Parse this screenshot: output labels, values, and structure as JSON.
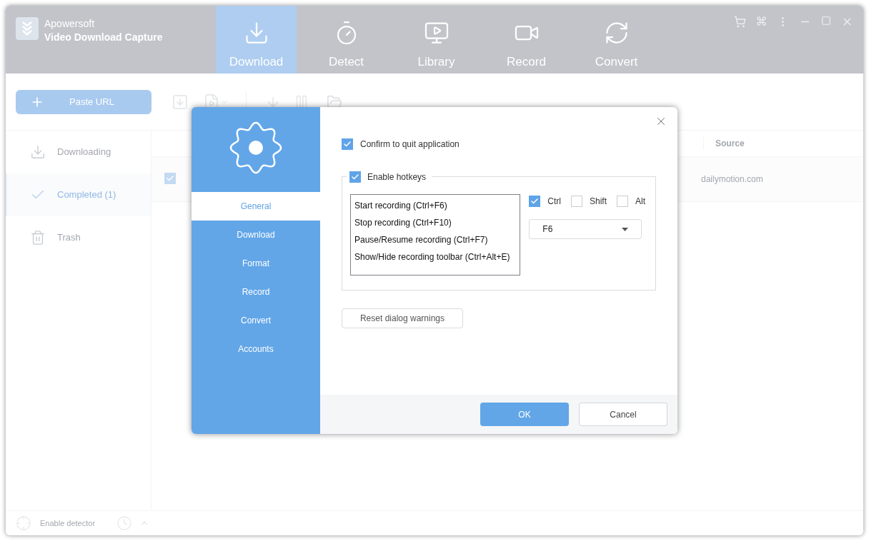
{
  "app": {
    "brand": "Apowersoft",
    "product": "Video Download Capture"
  },
  "nav_tabs": [
    {
      "label": "Download",
      "selected": true
    },
    {
      "label": "Detect",
      "selected": false
    },
    {
      "label": "Library",
      "selected": false
    },
    {
      "label": "Record",
      "selected": false
    },
    {
      "label": "Convert",
      "selected": false
    }
  ],
  "toolbar": {
    "paste_url": "Paste URL"
  },
  "sidebar": {
    "items": [
      {
        "label": "Downloading",
        "selected": false
      },
      {
        "label": "Completed (1)",
        "selected": true
      },
      {
        "label": "Trash",
        "selected": false
      }
    ]
  },
  "table": {
    "columns": [
      {
        "label": "Source"
      }
    ],
    "rows": [
      {
        "checked": true,
        "source": "dailymotion.com"
      }
    ]
  },
  "status_bar": {
    "detector": "Enable detector"
  },
  "dialog": {
    "nav": [
      {
        "label": "General",
        "selected": true
      },
      {
        "label": "Download",
        "selected": false
      },
      {
        "label": "Format",
        "selected": false
      },
      {
        "label": "Record",
        "selected": false
      },
      {
        "label": "Convert",
        "selected": false
      },
      {
        "label": "Accounts",
        "selected": false
      }
    ],
    "confirm_quit": {
      "label": "Confirm to quit application",
      "checked": true
    },
    "hotkeys": {
      "label": "Enable hotkeys",
      "checked": true,
      "actions": [
        "Start recording (Ctrl+F6)",
        "Stop recording (Ctrl+F10)",
        "Pause/Resume recording (Ctrl+F7)",
        "Show/Hide recording toolbar (Ctrl+Alt+E)"
      ],
      "modifiers": [
        {
          "label": "Ctrl",
          "checked": true
        },
        {
          "label": "Shift",
          "checked": false
        },
        {
          "label": "Alt",
          "checked": false
        }
      ],
      "key": "F6"
    },
    "reset_button": "Reset dialog warnings",
    "ok": "OK",
    "cancel": "Cancel"
  }
}
